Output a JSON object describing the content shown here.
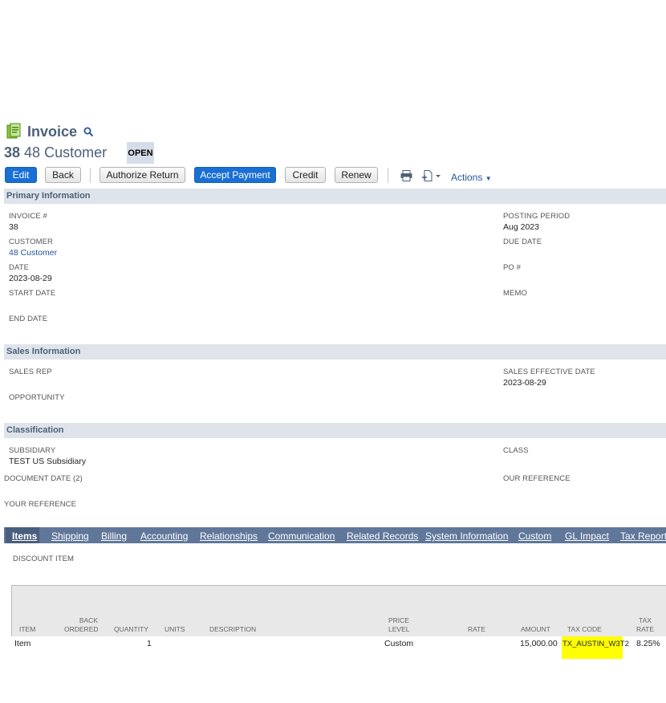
{
  "header": {
    "title": "Invoice",
    "record_number": "38",
    "record_name": "48 Customer",
    "status": "OPEN"
  },
  "toolbar": {
    "edit": "Edit",
    "back": "Back",
    "authorize_return": "Authorize Return",
    "accept_payment": "Accept Payment",
    "credit": "Credit",
    "renew": "Renew",
    "actions": "Actions"
  },
  "primary": {
    "section_title": "Primary Information",
    "invoice_label": "INVOICE #",
    "invoice_value": "38",
    "customer_label": "CUSTOMER",
    "customer_value": "48 Customer",
    "date_label": "DATE",
    "date_value": "2023-08-29",
    "start_date_label": "START DATE",
    "end_date_label": "END DATE",
    "posting_period_label": "POSTING PERIOD",
    "posting_period_value": "Aug 2023",
    "due_date_label": "DUE DATE",
    "po_label": "PO #",
    "memo_label": "MEMO"
  },
  "sales": {
    "section_title": "Sales Information",
    "sales_rep_label": "SALES REP",
    "opportunity_label": "OPPORTUNITY",
    "effective_date_label": "SALES EFFECTIVE DATE",
    "effective_date_value": "2023-08-29"
  },
  "classification": {
    "section_title": "Classification",
    "subsidiary_label": "SUBSIDIARY",
    "subsidiary_value": "TEST US Subsidiary",
    "class_label": "CLASS",
    "document_date_label": "DOCUMENT DATE (2)",
    "our_reference_label": "OUR REFERENCE",
    "your_reference_label": "YOUR REFERENCE"
  },
  "tabs": [
    "Items",
    "Shipping",
    "Billing",
    "Accounting",
    "Relationships",
    "Communication",
    "Related Records",
    "System Information",
    "Custom",
    "GL Impact",
    "Tax Reporting"
  ],
  "items": {
    "discount_label": "DISCOUNT ITEM",
    "columns": {
      "item": "ITEM",
      "back_ordered_1": "BACK",
      "back_ordered_2": "ORDERED",
      "quantity": "QUANTITY",
      "units": "UNITS",
      "description": "DESCRIPTION",
      "price_level_1": "PRICE",
      "price_level_2": "LEVEL",
      "rate": "RATE",
      "amount": "AMOUNT",
      "tax_code": "TAX CODE",
      "tax_rate_1": "TAX",
      "tax_rate_2": "RATE"
    },
    "row": {
      "item": "Item",
      "quantity": "1",
      "price_level": "Custom",
      "amount": "15,000.00",
      "tax_code": "TX_AUSTIN_W3T2",
      "tax_rate": "8.25%"
    }
  },
  "colors": {
    "accent": "#1a6fd4",
    "section_bg": "#dfe4eb",
    "tab_bar": "#607799",
    "highlight": "#ffff00"
  }
}
